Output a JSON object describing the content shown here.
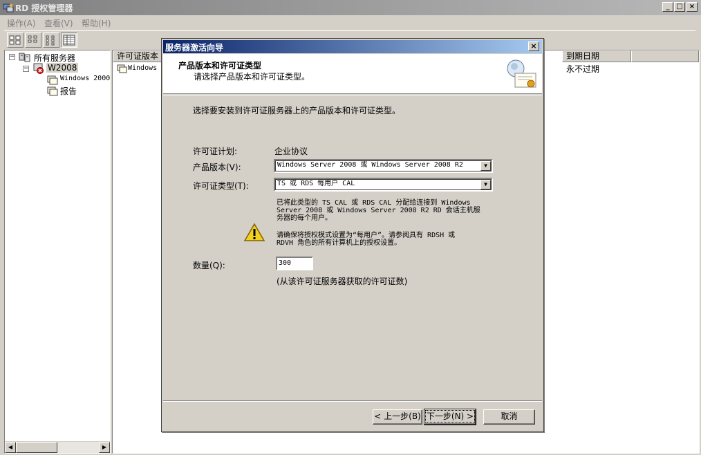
{
  "window": {
    "title": "RD 授权管理器",
    "min_glyph": "_",
    "max_glyph": "□",
    "close_glyph": "×"
  },
  "menu": [
    {
      "label": "操作(A)"
    },
    {
      "label": "查看(V)"
    },
    {
      "label": "帮助(H)"
    }
  ],
  "tree": {
    "root_label": "所有服务器",
    "server_label": "W2008",
    "child_license": "Windows 2000",
    "child_report": "报告"
  },
  "list": {
    "col_license_version": "许可证版本",
    "col_expiry": "到期日期",
    "row_license": "Windows",
    "row_expiry": "永不过期"
  },
  "dialog": {
    "title": "服务器激活向导",
    "close_glyph": "×",
    "header_title": "产品版本和许可证类型",
    "header_subtitle": "请选择产品版本和许可证类型。",
    "intro": "选择要安装到许可证服务器上的产品版本和许可证类型。",
    "license_program_label": "许可证计划:",
    "license_program_value": "企业协议",
    "product_version_label": "产品版本(V):",
    "product_version_value": "Windows Server 2008 或 Windows Server 2008 R2",
    "license_type_label": "许可证类型(T):",
    "license_type_value": "TS 或 RDS 每用户 CAL",
    "description_line1": "已将此类型的 TS CAL 或 RDS CAL 分配给连接到 Windows",
    "description_line2": "Server 2008 或 Windows Server 2008 R2 RD 会话主机服",
    "description_line3": "务器的每个用户。",
    "warning_line1": "请确保将授权模式设置为“每用户”。请参阅具有 RDSH 或",
    "warning_line2": "RDVH 角色的所有计算机上的授权设置。",
    "quantity_label": "数量(Q):",
    "quantity_value": "300",
    "quantity_hint": "(从该许可证服务器获取的许可证数)",
    "back_button": "< 上一步(B)",
    "next_button": "下一步(N) >",
    "cancel_button": "取消"
  }
}
